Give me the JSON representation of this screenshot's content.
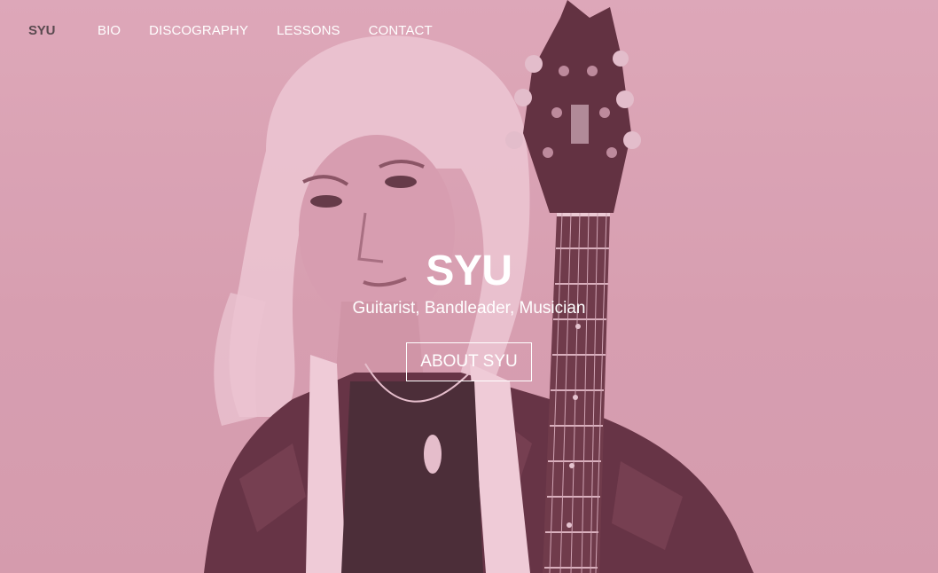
{
  "navbar": {
    "brand": "SYU",
    "links": [
      {
        "label": "BIO"
      },
      {
        "label": "DISCOGRAPHY"
      },
      {
        "label": "LESSONS"
      },
      {
        "label": "CONTACT"
      }
    ]
  },
  "hero": {
    "title": "SYU",
    "subtitle": "Guitarist, Bandleader, Musician",
    "button_label": "ABOUT SYU",
    "background_image": "guitarist-with-electric-guitar-photo",
    "overlay_color": "#d9a6b6",
    "text_color": "#ffffff"
  }
}
